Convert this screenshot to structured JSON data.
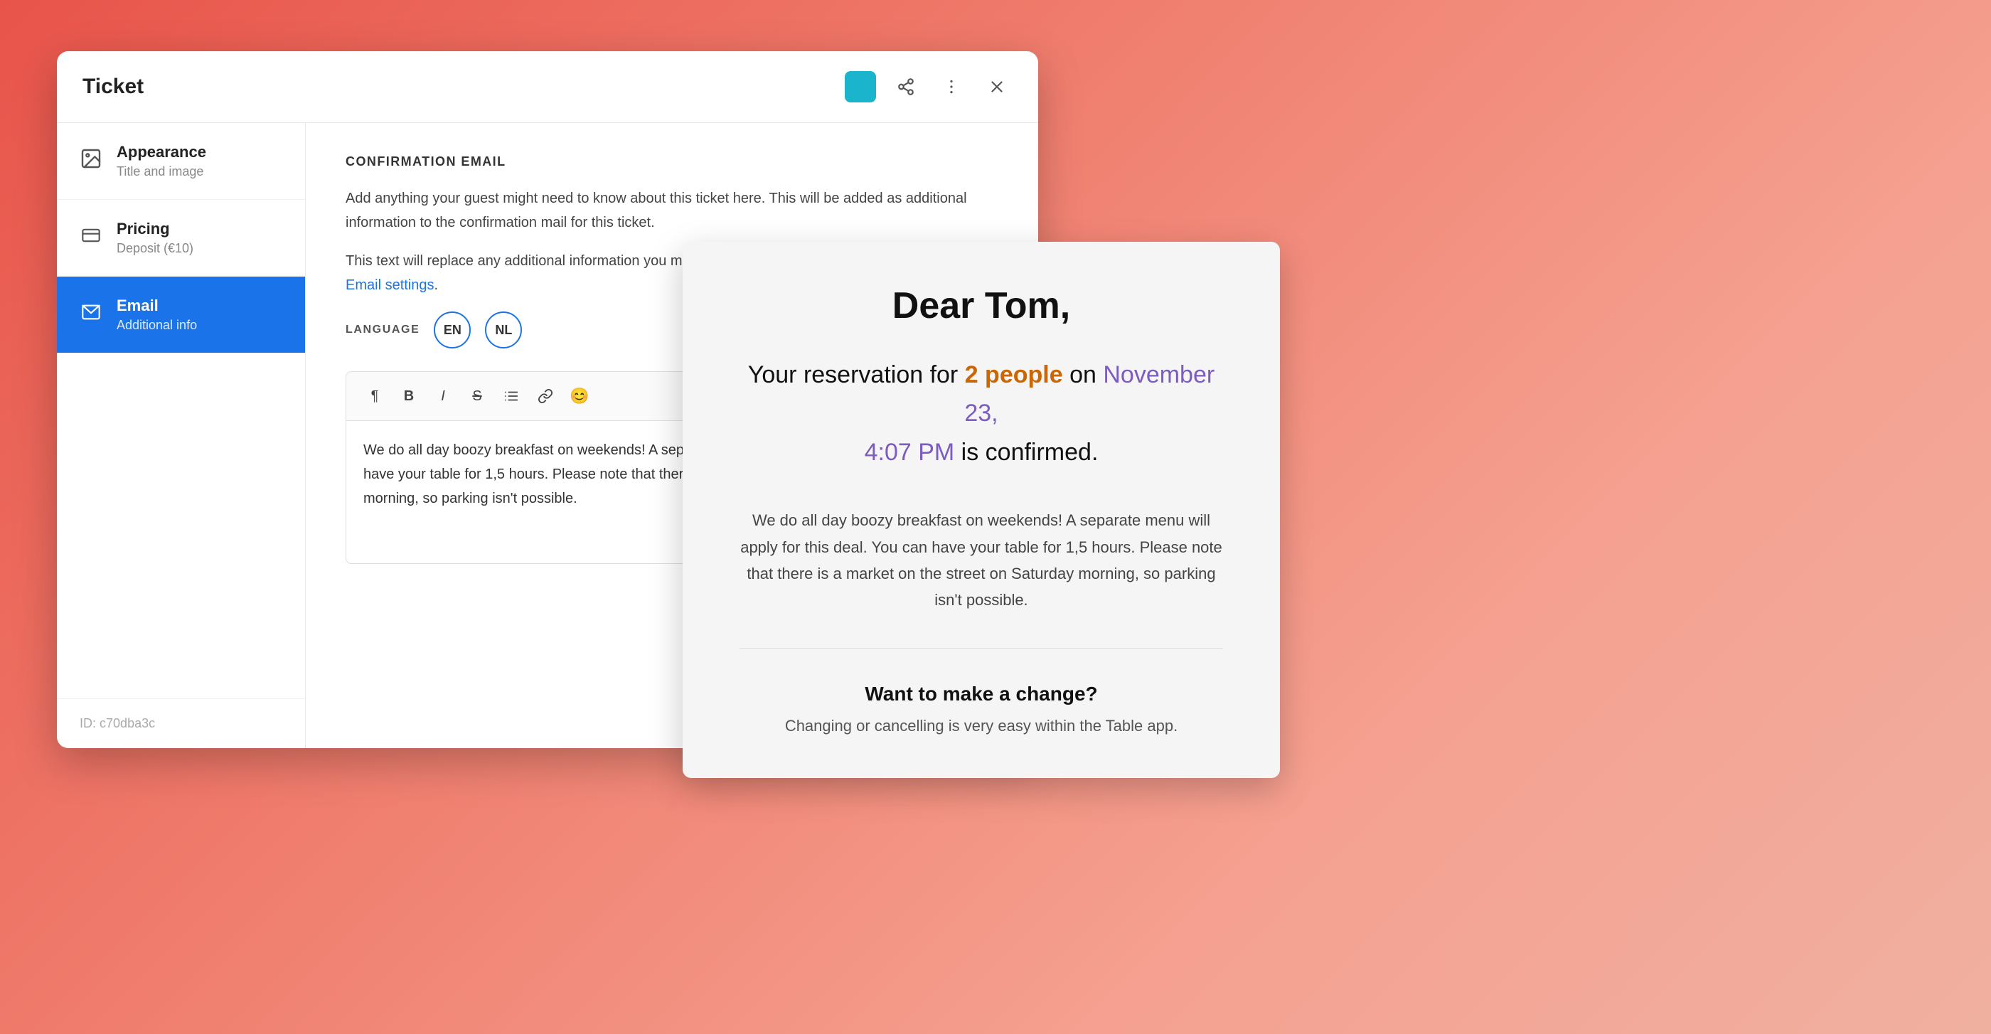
{
  "background": {
    "gradient_start": "#e8544a",
    "gradient_end": "#f0b0a0"
  },
  "ticket_modal": {
    "title": "Ticket",
    "close_label": "×",
    "id_label": "ID:",
    "id_value": "c70dba3c"
  },
  "sidebar": {
    "items": [
      {
        "id": "appearance",
        "title": "Appearance",
        "subtitle": "Title and image",
        "active": false,
        "icon": "image-icon"
      },
      {
        "id": "pricing",
        "title": "Pricing",
        "subtitle": "Deposit (€10)",
        "active": false,
        "icon": "card-icon"
      },
      {
        "id": "email",
        "title": "Email",
        "subtitle": "Additional info",
        "active": true,
        "icon": "email-icon"
      }
    ]
  },
  "main_content": {
    "section_title": "CONFIRMATION EMAIL",
    "desc1": "Add anything your guest might need to know about this ticket here. This will be added as additional information to the confirmation mail for this ticket.",
    "desc2_prefix": "This text will replace any additional information you might have set for the confirmation mail ",
    "desc2_link_text": "in your Email settings",
    "desc2_suffix": ".",
    "language_label": "LANGUAGE",
    "languages": [
      {
        "code": "EN",
        "active": true
      },
      {
        "code": "NL",
        "active": false
      }
    ],
    "toolbar": {
      "paragraph_icon": "¶",
      "bold_icon": "B",
      "italic_icon": "I",
      "strikethrough_icon": "S",
      "list_icon": "≡",
      "link_icon": "⛓",
      "emoji_icon": "😊"
    },
    "editor_content": "We do all day boozy breakfast on weekends! A separate menu will apply for this deal. You can have your table for 1,5 hours. Please note that there is a market on the street on Saturday morning, so parking isn't possible."
  },
  "email_preview": {
    "greeting": "Dear Tom,",
    "reservation_prefix": "Your reservation for ",
    "people_count": "2 people",
    "date_prefix": " on ",
    "date": "November 23,",
    "time": "4:07 PM",
    "time_suffix": " is confirmed.",
    "body_text": "We do all day boozy breakfast on weekends! A separate menu will apply for this deal. You can have your table for 1,5 hours. Please note that there is a market on the street on Saturday morning, so parking isn't possible.",
    "cta_title": "Want to make a change?",
    "cta_text": "Changing or cancelling is very easy within the Table app."
  }
}
